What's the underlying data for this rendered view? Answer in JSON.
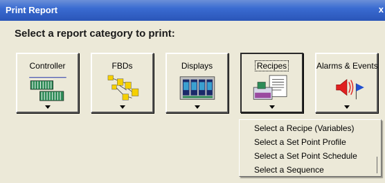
{
  "window": {
    "title": "Print Report",
    "close_glyph": "x"
  },
  "prompt": "Select a report category to print:",
  "categories": [
    {
      "label": "Controller",
      "icon": "controller-icon"
    },
    {
      "label": "FBDs",
      "icon": "fbd-icon"
    },
    {
      "label": "Displays",
      "icon": "displays-icon"
    },
    {
      "label": "Recipes",
      "icon": "recipes-icon",
      "selected": true
    },
    {
      "label": "Alarms & Events",
      "icon": "alarms-events-icon"
    }
  ],
  "recipes_menu": {
    "items": [
      "Select a Recipe (Variables)",
      "Select a Set Point Profile",
      "Select a Set Point Schedule",
      "Select a Sequence"
    ]
  },
  "colors": {
    "titlebar": "#2a55b8",
    "window_bg": "#ece9d8",
    "accent_yellow": "#f5d000",
    "accent_green": "#2e8b57"
  }
}
